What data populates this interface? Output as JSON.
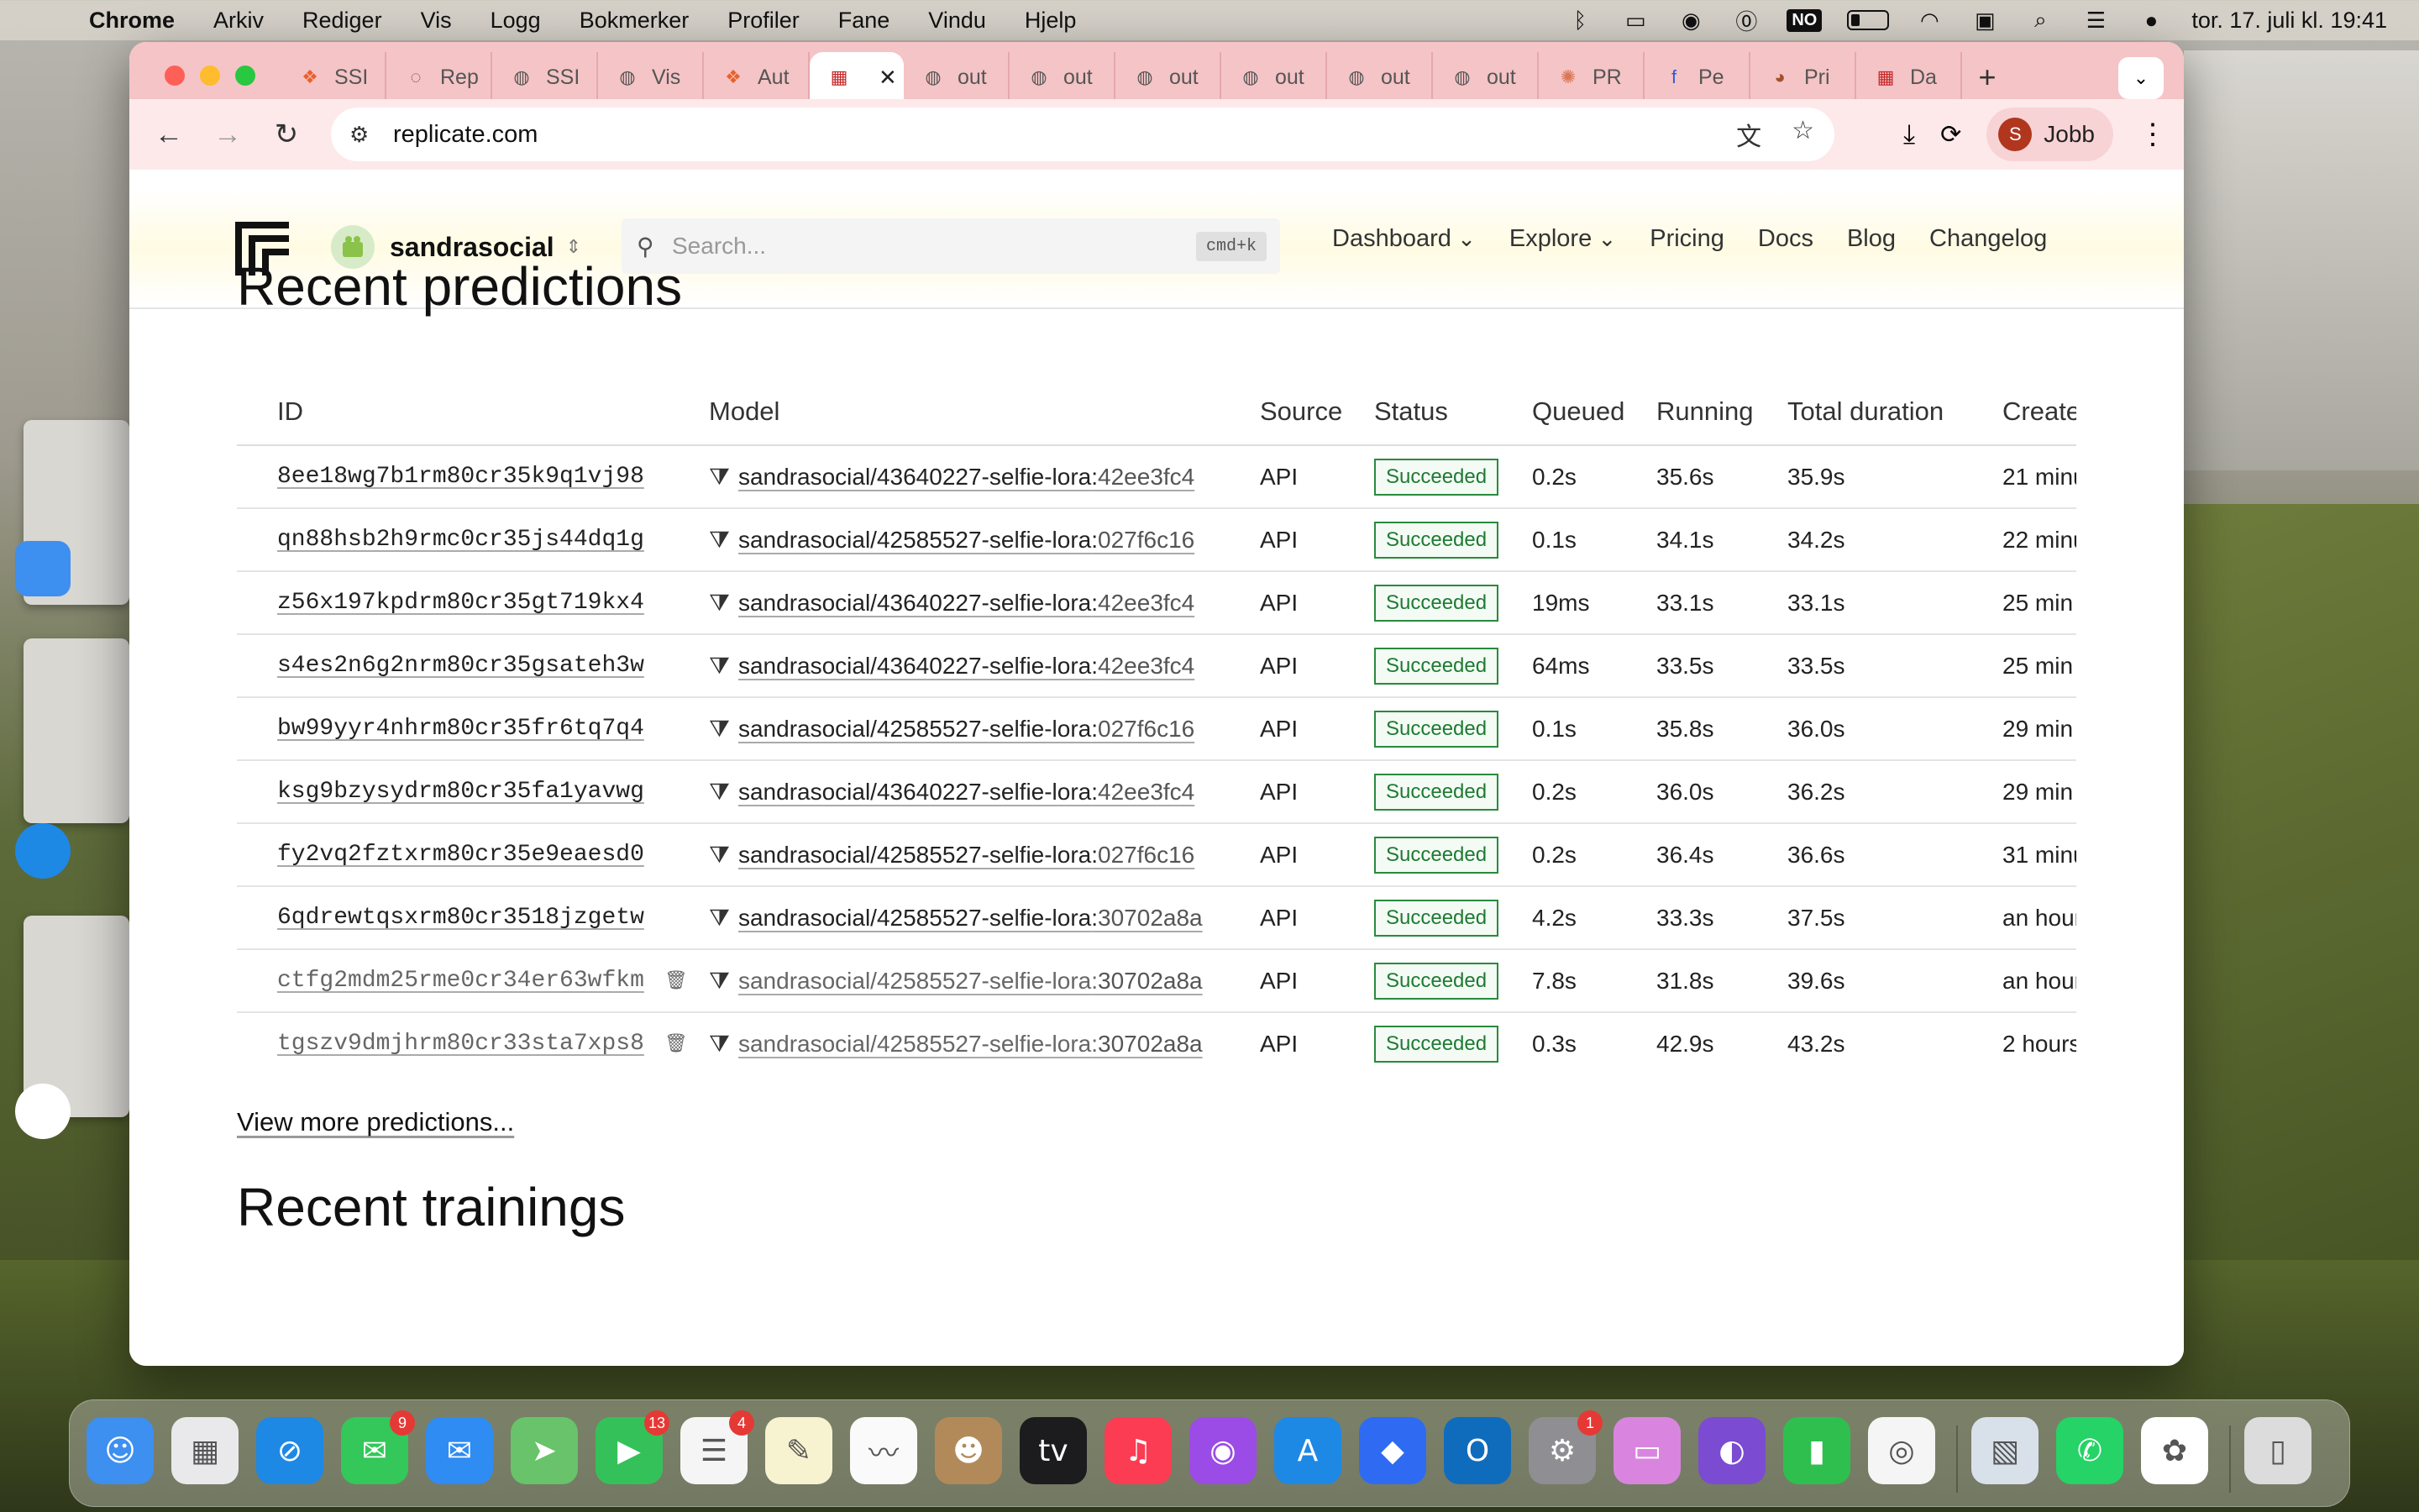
{
  "menubar": {
    "app": "Chrome",
    "items": [
      "Arkiv",
      "Rediger",
      "Vis",
      "Logg",
      "Bokmerker",
      "Profiler",
      "Fane",
      "Vindu",
      "Hjelp"
    ],
    "input_source": "NO",
    "datetime": "tor. 17. juli kl. 19:41"
  },
  "tabs": [
    {
      "label": "SSI",
      "icon": "tab-favicon-orange"
    },
    {
      "label": "Rep",
      "icon": "loading-spinner-icon"
    },
    {
      "label": "SSI",
      "icon": "globe-icon"
    },
    {
      "label": "Vis",
      "icon": "globe-icon"
    },
    {
      "label": "Aut",
      "icon": "tab-favicon-orange"
    },
    {
      "label": "",
      "icon": "replicate-icon",
      "active": true
    },
    {
      "label": "out",
      "icon": "globe-icon"
    },
    {
      "label": "out",
      "icon": "globe-icon"
    },
    {
      "label": "out",
      "icon": "globe-icon"
    },
    {
      "label": "out",
      "icon": "globe-icon"
    },
    {
      "label": "out",
      "icon": "globe-icon"
    },
    {
      "label": "out",
      "icon": "globe-icon"
    },
    {
      "label": "PR",
      "icon": "claude-icon"
    },
    {
      "label": "Pe",
      "icon": "fal-icon"
    },
    {
      "label": "Pri",
      "icon": "avatar-icon"
    },
    {
      "label": "Da",
      "icon": "replicate-icon"
    }
  ],
  "toolbar": {
    "url": "replicate.com",
    "profile_initial": "S",
    "profile_name": "Jobb"
  },
  "site": {
    "org_name": "sandrasocial",
    "search_placeholder": "Search...",
    "search_shortcut": "cmd+k",
    "nav": [
      "Dashboard",
      "Explore",
      "Pricing",
      "Docs",
      "Blog",
      "Changelog"
    ]
  },
  "predictions": {
    "title": "Recent predictions",
    "columns": [
      "ID",
      "Model",
      "Source",
      "Status",
      "Queued",
      "Running",
      "Total duration",
      "Create"
    ],
    "rows": [
      {
        "id": "8ee18wg7b1rm80cr35k9q1vj98",
        "model": "sandrasocial/43640227-selfie-lora",
        "version": "42ee3fc4",
        "source": "API",
        "status": "Succeeded",
        "queued": "0.2s",
        "running": "35.6s",
        "total": "35.9s",
        "created": "21 minu"
      },
      {
        "id": "qn88hsb2h9rmc0cr35js44dq1g",
        "model": "sandrasocial/42585527-selfie-lora",
        "version": "027f6c16",
        "source": "API",
        "status": "Succeeded",
        "queued": "0.1s",
        "running": "34.1s",
        "total": "34.2s",
        "created": "22 minu"
      },
      {
        "id": "z56x197kpdrm80cr35gt719kx4",
        "model": "sandrasocial/43640227-selfie-lora",
        "version": "42ee3fc4",
        "source": "API",
        "status": "Succeeded",
        "queued": "19ms",
        "running": "33.1s",
        "total": "33.1s",
        "created": "25 min"
      },
      {
        "id": "s4es2n6g2nrm80cr35gsateh3w",
        "model": "sandrasocial/43640227-selfie-lora",
        "version": "42ee3fc4",
        "source": "API",
        "status": "Succeeded",
        "queued": "64ms",
        "running": "33.5s",
        "total": "33.5s",
        "created": "25 min"
      },
      {
        "id": "bw99yyr4nhrm80cr35fr6tq7q4",
        "model": "sandrasocial/42585527-selfie-lora",
        "version": "027f6c16",
        "source": "API",
        "status": "Succeeded",
        "queued": "0.1s",
        "running": "35.8s",
        "total": "36.0s",
        "created": "29 min"
      },
      {
        "id": "ksg9bzysydrm80cr35fa1yavwg",
        "model": "sandrasocial/43640227-selfie-lora",
        "version": "42ee3fc4",
        "source": "API",
        "status": "Succeeded",
        "queued": "0.2s",
        "running": "36.0s",
        "total": "36.2s",
        "created": "29 min"
      },
      {
        "id": "fy2vq2fztxrm80cr35e9eaesd0",
        "model": "sandrasocial/42585527-selfie-lora",
        "version": "027f6c16",
        "source": "API",
        "status": "Succeeded",
        "queued": "0.2s",
        "running": "36.4s",
        "total": "36.6s",
        "created": "31 minu"
      },
      {
        "id": "6qdrewtqsxrm80cr3518jzgetw",
        "model": "sandrasocial/42585527-selfie-lora",
        "version": "30702a8a",
        "source": "API",
        "status": "Succeeded",
        "queued": "4.2s",
        "running": "33.3s",
        "total": "37.5s",
        "created": "an hour"
      },
      {
        "id": "ctfg2mdm25rme0cr34er63wfkm",
        "model": "sandrasocial/42585527-selfie-lora",
        "version": "30702a8a",
        "source": "API",
        "status": "Succeeded",
        "queued": "7.8s",
        "running": "31.8s",
        "total": "39.6s",
        "created": "an hour",
        "deleted": true
      },
      {
        "id": "tgszv9dmjhrm80cr33sta7xps8",
        "model": "sandrasocial/42585527-selfie-lora",
        "version": "30702a8a",
        "source": "API",
        "status": "Succeeded",
        "queued": "0.3s",
        "running": "42.9s",
        "total": "43.2s",
        "created": "2 hours",
        "deleted": true
      }
    ],
    "view_more": "View more predictions..."
  },
  "trainings": {
    "title": "Recent trainings"
  },
  "dock": {
    "apps": [
      {
        "name": "Finder",
        "color": "#3d8ff0"
      },
      {
        "name": "Launchpad",
        "color": "#e9e9ec"
      },
      {
        "name": "Safari",
        "color": "#1e88e5"
      },
      {
        "name": "Messages",
        "color": "#34c759",
        "badge": "9"
      },
      {
        "name": "Mail",
        "color": "#2f8cf2"
      },
      {
        "name": "Maps",
        "color": "#68c36a"
      },
      {
        "name": "FaceTime",
        "color": "#35c159",
        "badge": "13"
      },
      {
        "name": "Reminders",
        "color": "#f5f5f5",
        "badge": "4"
      },
      {
        "name": "Notes",
        "color": "#f7f2d0"
      },
      {
        "name": "Freeform",
        "color": "#fafafa"
      },
      {
        "name": "Contacts",
        "color": "#b28a5a"
      },
      {
        "name": "Apple TV",
        "color": "#1c1c1e"
      },
      {
        "name": "Music",
        "color": "#fb3c52"
      },
      {
        "name": "Podcasts",
        "color": "#9b4be6"
      },
      {
        "name": "App Store",
        "color": "#1e88e5"
      },
      {
        "name": "Roblox Studio",
        "color": "#2f6bf2"
      },
      {
        "name": "Outlook",
        "color": "#0f6cbd"
      },
      {
        "name": "System Settings",
        "color": "#8e8e93",
        "badge": "1"
      },
      {
        "name": "Keynote",
        "color": "#d985e0"
      },
      {
        "name": "GitHub Desktop",
        "color": "#7b4bd1"
      },
      {
        "name": "Numbers",
        "color": "#2fbf4f"
      },
      {
        "name": "Chrome",
        "color": "#f5f5f5"
      },
      {
        "name": "Preview",
        "color": "#d8e0ea"
      },
      {
        "name": "WhatsApp",
        "color": "#25d366"
      },
      {
        "name": "Photos",
        "color": "#ffffff"
      },
      {
        "name": "Trash",
        "color": "#dcdcdc"
      }
    ]
  }
}
